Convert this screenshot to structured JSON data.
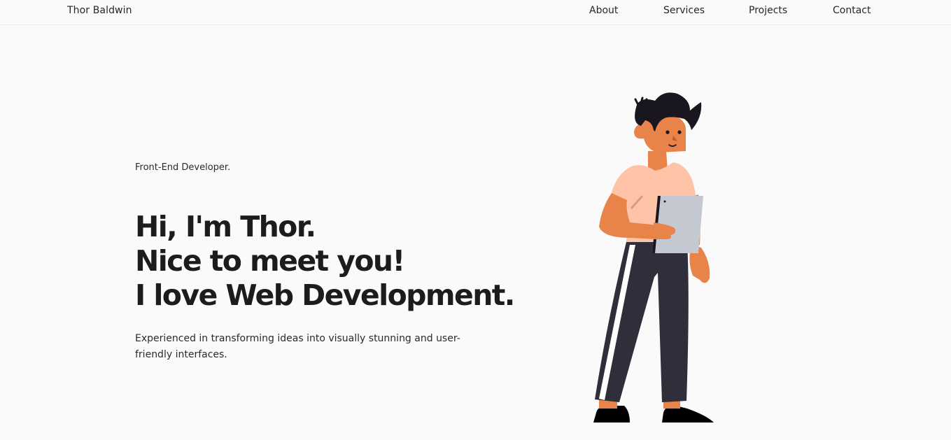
{
  "header": {
    "brand": "Thor Baldwin",
    "nav": [
      {
        "label": "About"
      },
      {
        "label": "Services"
      },
      {
        "label": "Projects"
      },
      {
        "label": "Contact"
      }
    ]
  },
  "hero": {
    "role": "Front-End Developer.",
    "heading": [
      "Hi, I'm Thor.",
      "Nice to meet you!",
      "I love Web Development."
    ],
    "description": "Experienced in transforming ideas into visually stunning and user-friendly interfaces."
  },
  "colors": {
    "background": "#fafafa",
    "text": "#1f1f1f",
    "skin": "#e8834a",
    "shirt": "#ffc4a8",
    "pants": "#2f2e3a",
    "hair": "#1a1620",
    "tablet": "#c4c8d0"
  }
}
